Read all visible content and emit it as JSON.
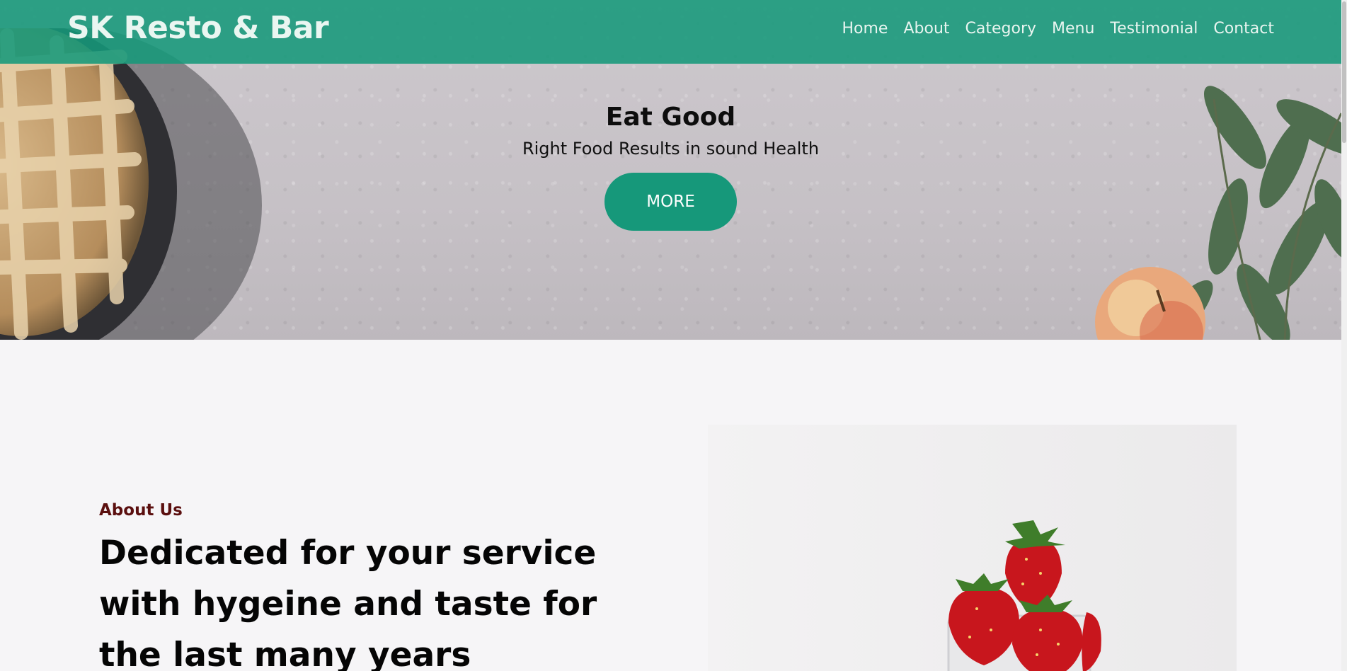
{
  "header": {
    "brand": "SK Resto & Bar",
    "nav": [
      {
        "label": "Home"
      },
      {
        "label": "About"
      },
      {
        "label": "Category"
      },
      {
        "label": "Menu"
      },
      {
        "label": "Testimonial"
      },
      {
        "label": "Contact"
      }
    ]
  },
  "hero": {
    "title": "Eat Good",
    "subtitle": "Right Food Results in sound Health",
    "button_label": "MORE"
  },
  "about": {
    "eyebrow": "About Us",
    "heading": "Dedicated for your service with hygeine and taste for the last many years"
  },
  "colors": {
    "accent": "#16987a",
    "eyebrow": "#5b0f0f",
    "background": "#f6f5f7"
  }
}
